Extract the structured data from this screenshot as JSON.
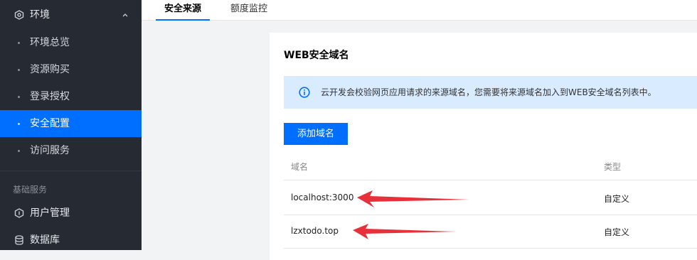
{
  "sidebar": {
    "group": {
      "label": "环境",
      "icon": "hexagon-icon",
      "chevron": "chevron-up-icon"
    },
    "items": [
      {
        "label": "环境总览"
      },
      {
        "label": "资源购买"
      },
      {
        "label": "登录授权"
      },
      {
        "label": "安全配置",
        "active": true
      },
      {
        "label": "访问服务"
      }
    ],
    "section_label": "基础服务",
    "services": [
      {
        "label": "用户管理",
        "icon": "user-management-icon"
      },
      {
        "label": "数据库",
        "icon": "database-icon"
      }
    ]
  },
  "tabs": [
    {
      "label": "安全来源",
      "active": true
    },
    {
      "label": "额度监控"
    }
  ],
  "card": {
    "title": "WEB安全域名",
    "notice": {
      "icon": "info-icon",
      "text": "云开发会校验网页应用请求的来源域名，您需要将来源域名加入到WEB安全域名列表中。"
    },
    "add_button": "添加域名",
    "table": {
      "headers": {
        "domain": "域名",
        "type": "类型"
      },
      "rows": [
        {
          "domain": "localhost:3000",
          "type": "自定义"
        },
        {
          "domain": "lzxtodo.top",
          "type": "自定义"
        }
      ]
    }
  },
  "colors": {
    "accent": "#006eff",
    "sidebar_bg": "#252a33",
    "notice_bg": "#d9ebff",
    "annotation_arrow": "#e8303a"
  }
}
